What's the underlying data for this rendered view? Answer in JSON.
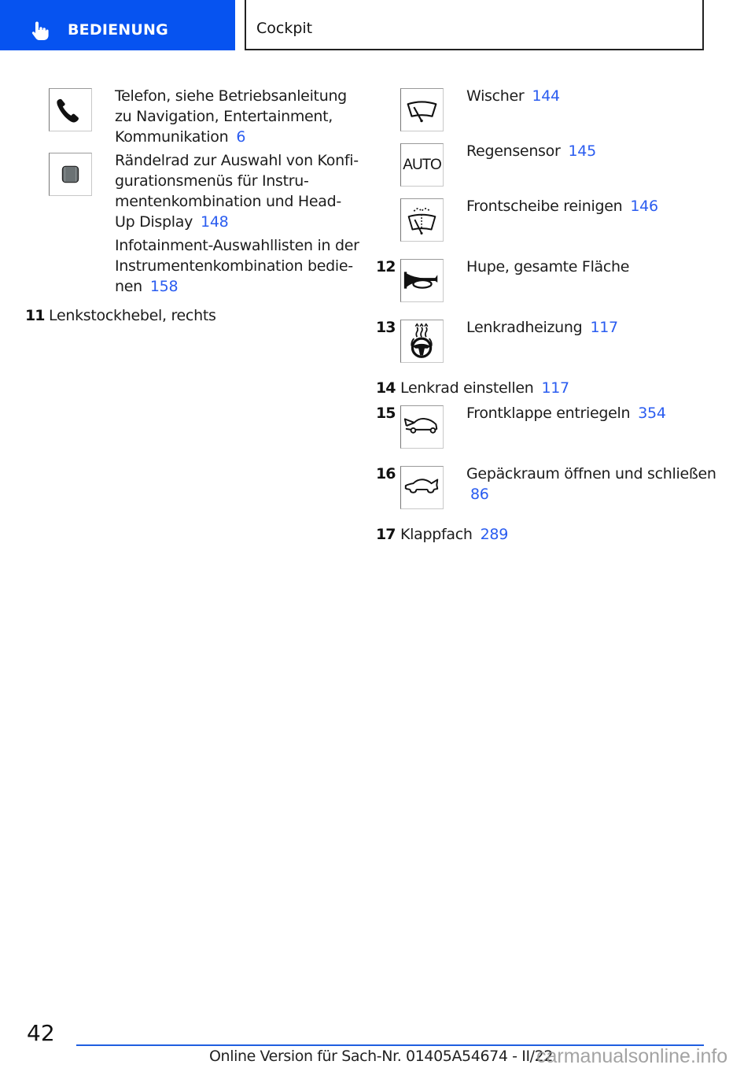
{
  "header": {
    "section_label": "BEDIENUNG",
    "section_icon": "hand-pointer-icon",
    "chapter_label": "Cockpit",
    "accent_color": "#0653f0"
  },
  "left_column": {
    "items": [
      {
        "icon": "phone-icon",
        "text_lines": [
          "Telefon, siehe Betriebsanleitung",
          "zu Navigation, Entertainment,",
          "Kommunikation"
        ],
        "ref": "6"
      },
      {
        "icon": "thumbwheel-icon",
        "text_lines": [
          "Rändelrad zur Auswahl von Konfi-",
          "gurationsmenüs für Instru-",
          "mentenkombination und Head-",
          "Up Display"
        ],
        "ref": "148"
      },
      {
        "icon": "",
        "text_lines": [
          "Infotainment-Auswahllisten in der",
          "Instrumentenkombination bedie-",
          "nen"
        ],
        "ref": "158"
      }
    ],
    "numbered": [
      {
        "number": "11",
        "text": "Lenkstockhebel, rechts"
      }
    ]
  },
  "right_column": {
    "items": [
      {
        "number": "",
        "icon": "wiper-icon",
        "text": "Wischer",
        "ref": "144"
      },
      {
        "number": "",
        "icon": "auto-rain-sensor-icon",
        "icon_text": "AUTO",
        "text": "Regensensor",
        "ref": "145"
      },
      {
        "number": "",
        "icon": "washer-icon",
        "text": "Frontscheibe reinigen",
        "ref": "146"
      },
      {
        "number": "12",
        "icon": "horn-icon",
        "text": "Hupe, gesamte Fläche",
        "ref": ""
      },
      {
        "number": "13",
        "icon": "steering-wheel-heating-icon",
        "text": "Lenkradheizung",
        "ref": "117"
      },
      {
        "number": "14",
        "icon": "",
        "text": "Lenkrad einstellen",
        "ref": "117"
      },
      {
        "number": "15",
        "icon": "front-hood-icon",
        "text": "Frontklappe entriegeln",
        "ref": "354"
      },
      {
        "number": "16",
        "icon": "trunk-icon",
        "text": "Gepäckraum öffnen und schließen",
        "ref": "86"
      },
      {
        "number": "17",
        "icon": "",
        "text": "Klappfach",
        "ref": "289"
      }
    ]
  },
  "footer": {
    "page_number": "42",
    "text": "Online Version für Sach-Nr. 01405A54674 - II/22",
    "watermark": "carmanualsonline.info",
    "line_color": "#1f5fe0"
  },
  "link_color": "#2a5cf0"
}
